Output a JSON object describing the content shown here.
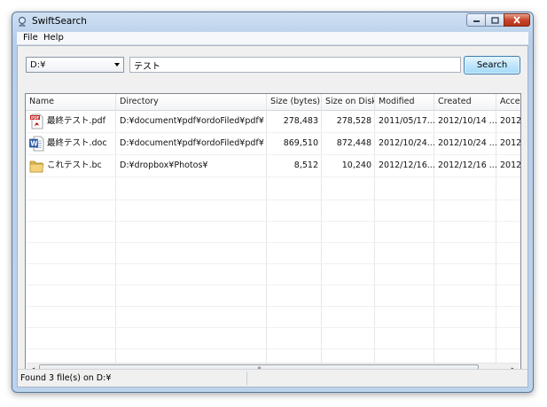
{
  "window": {
    "title": "SwiftSearch"
  },
  "menu": [
    "File",
    "Help"
  ],
  "toolbar": {
    "drive": "D:¥",
    "query": "テスト",
    "search_label": "Search"
  },
  "table": {
    "columns": [
      "Name",
      "Directory",
      "Size (bytes)",
      "Size on Disk",
      "Modified",
      "Created",
      "Acces"
    ],
    "rows": [
      {
        "icon": "pdf-file-icon",
        "name": "最終テスト.pdf",
        "directory": "D:¥document¥pdf¥ordoFiled¥pdf¥",
        "size": "278,483",
        "size_on_disk": "278,528",
        "modified": "2011/05/17...",
        "created": "2012/10/14 ...",
        "accessed": "2012/"
      },
      {
        "icon": "word-document-icon",
        "name": "最終テスト.doc",
        "directory": "D:¥document¥pdf¥ordoFiled¥pdf¥",
        "size": "869,510",
        "size_on_disk": "872,448",
        "modified": "2012/10/24...",
        "created": "2012/10/24 ...",
        "accessed": "2012/"
      },
      {
        "icon": "folder-icon",
        "name": "これテスト.bc",
        "directory": "D:¥dropbox¥Photos¥",
        "size": "8,512",
        "size_on_disk": "10,240",
        "modified": "2012/12/16...",
        "created": "2012/12/16 ...",
        "accessed": "2012/"
      }
    ]
  },
  "status": {
    "text": "Found 3 file(s) on D:¥"
  }
}
